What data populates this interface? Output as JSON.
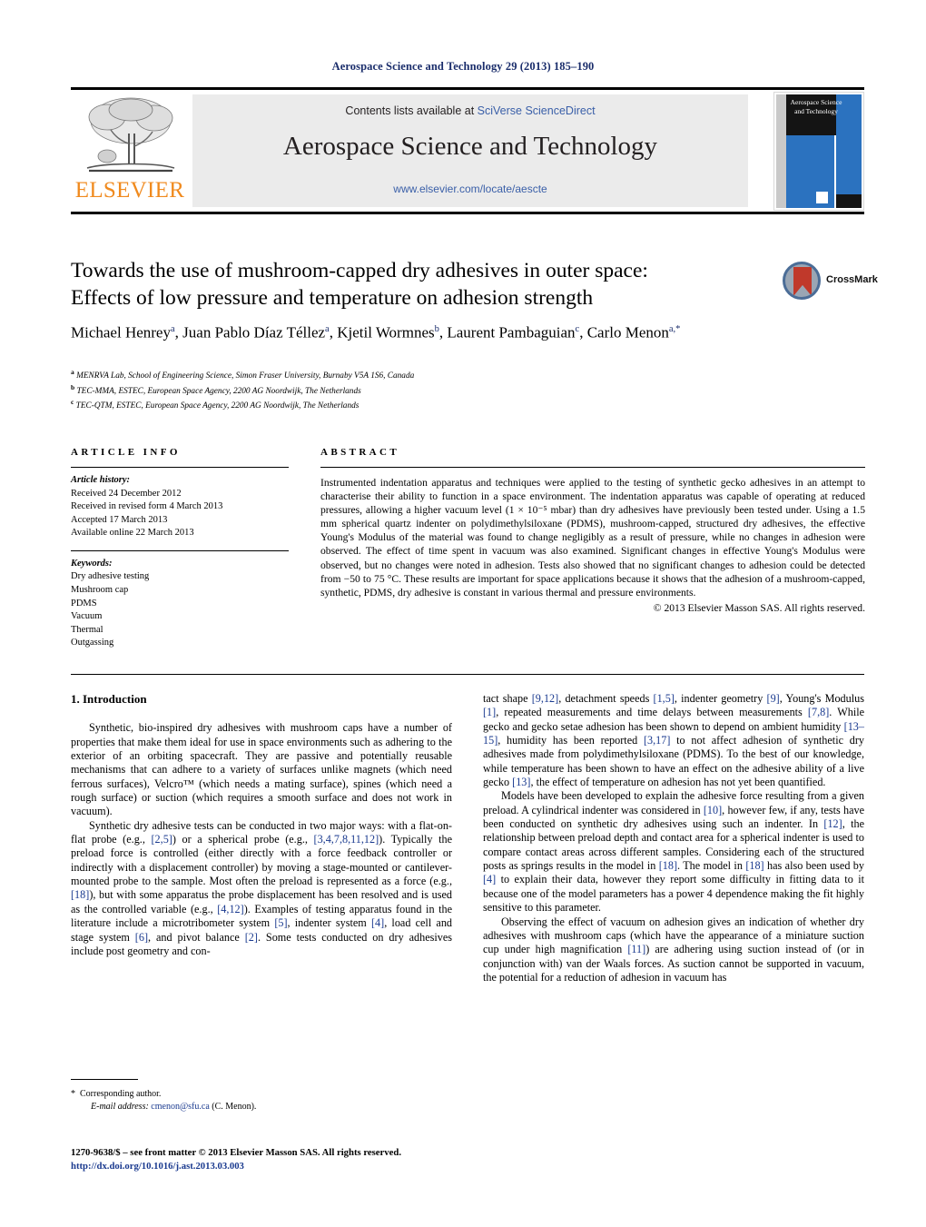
{
  "running_head": "Aerospace Science and Technology 29 (2013) 185–190",
  "masthead": {
    "publisher_name": "ELSEVIER",
    "contents_prefix": "Contents lists available at ",
    "sciencedirect_link": "SciVerse ScienceDirect",
    "journal_title": "Aerospace Science and Technology",
    "journal_url": "www.elsevier.com/locate/aescte",
    "cover_title": "Aerospace Science and Technology"
  },
  "article": {
    "title_line1": "Towards the use of mushroom-capped dry adhesives in outer space:",
    "title_line2": "Effects of low pressure and temperature on adhesion strength",
    "authors": [
      {
        "name": "Michael Henrey",
        "sup": "a",
        "sep": ", "
      },
      {
        "name": "Juan Pablo Díaz Téllez",
        "sup": "a",
        "sep": ", "
      },
      {
        "name": "Kjetil Wormnes",
        "sup": "b",
        "sep": ", "
      },
      {
        "name": "Laurent Pambaguian",
        "sup": "c",
        "sep": ", "
      },
      {
        "name": "Carlo Menon",
        "sup": "a,*",
        "sep": ""
      }
    ],
    "affiliations": [
      {
        "marker": "a",
        "text": "MENRVA Lab, School of Engineering Science, Simon Fraser University, Burnaby V5A 1S6, Canada"
      },
      {
        "marker": "b",
        "text": "TEC-MMA, ESTEC, European Space Agency, 2200 AG Noordwijk, The Netherlands"
      },
      {
        "marker": "c",
        "text": "TEC-QTM, ESTEC, European Space Agency, 2200 AG Noordwijk, The Netherlands"
      }
    ],
    "crossmark_label": "CrossMark"
  },
  "article_info": {
    "heading": "ARTICLE INFO",
    "history_label": "Article history:",
    "history": [
      "Received 24 December 2012",
      "Received in revised form 4 March 2013",
      "Accepted 17 March 2013",
      "Available online 22 March 2013"
    ],
    "keywords_label": "Keywords:",
    "keywords": [
      "Dry adhesive testing",
      "Mushroom cap",
      "PDMS",
      "Vacuum",
      "Thermal",
      "Outgassing"
    ]
  },
  "abstract": {
    "heading": "ABSTRACT",
    "text": "Instrumented indentation apparatus and techniques were applied to the testing of synthetic gecko adhesives in an attempt to characterise their ability to function in a space environment. The indentation apparatus was capable of operating at reduced pressures, allowing a higher vacuum level (1 × 10⁻⁵ mbar) than dry adhesives have previously been tested under. Using a 1.5 mm spherical quartz indenter on polydimethylsiloxane (PDMS), mushroom-capped, structured dry adhesives, the effective Young's Modulus of the material was found to change negligibly as a result of pressure, while no changes in adhesion were observed. The effect of time spent in vacuum was also examined. Significant changes in effective Young's Modulus were observed, but no changes were noted in adhesion. Tests also showed that no significant changes to adhesion could be detected from −50 to 75 °C. These results are important for space applications because it shows that the adhesion of a mushroom-capped, synthetic, PDMS, dry adhesive is constant in various thermal and pressure environments.",
    "copyright": "© 2013 Elsevier Masson SAS. All rights reserved."
  },
  "body": {
    "section_heading": "1. Introduction",
    "left_paragraphs": [
      "Synthetic, bio-inspired dry adhesives with mushroom caps have a number of properties that make them ideal for use in space environments such as adhering to the exterior of an orbiting spacecraft. They are passive and potentially reusable mechanisms that can adhere to a variety of surfaces unlike magnets (which need ferrous surfaces), Velcro™ (which needs a mating surface), spines (which need a rough surface) or suction (which requires a smooth surface and does not work in vacuum).",
      "Synthetic dry adhesive tests can be conducted in two major ways: with a flat-on-flat probe (e.g., [2,5]) or a spherical probe (e.g., [3,4,7,8,11,12]). Typically the preload force is controlled (either directly with a force feedback controller or indirectly with a displacement controller) by moving a stage-mounted or cantilever-mounted probe to the sample. Most often the preload is represented as a force (e.g., [18]), but with some apparatus the probe displacement has been resolved and is used as the controlled variable (e.g., [4,12]). Examples of testing apparatus found in the literature include a microtribometer system [5], indenter system [4], load cell and stage system [6], and pivot balance [2]. Some tests conducted on dry adhesives include post geometry and con-"
    ],
    "right_paragraphs": [
      "tact shape [9,12], detachment speeds [1,5], indenter geometry [9], Young's Modulus [1], repeated measurements and time delays between measurements [7,8]. While gecko and gecko setae adhesion has been shown to depend on ambient humidity [13–15], humidity has been reported [3,17] to not affect adhesion of synthetic dry adhesives made from polydimethylsiloxane (PDMS). To the best of our knowledge, while temperature has been shown to have an effect on the adhesive ability of a live gecko [13], the effect of temperature on adhesion has not yet been quantified.",
      "Models have been developed to explain the adhesive force resulting from a given preload. A cylindrical indenter was considered in [10], however few, if any, tests have been conducted on synthetic dry adhesives using such an indenter. In [12], the relationship between preload depth and contact area for a spherical indenter is used to compare contact areas across different samples. Considering each of the structured posts as springs results in the model in [18]. The model in [18] has also been used by [4] to explain their data, however they report some difficulty in fitting data to it because one of the model parameters has a power 4 dependence making the fit highly sensitive to this parameter.",
      "Observing the effect of vacuum on adhesion gives an indication of whether dry adhesives with mushroom caps (which have the appearance of a miniature suction cup under high magnification [11]) are adhering using suction instead of (or in conjunction with) van der Waals forces. As suction cannot be supported in vacuum, the potential for a reduction of adhesion in vacuum has"
    ]
  },
  "footnotes": {
    "corresponding_marker": "*",
    "corresponding_text": "Corresponding author.",
    "email_label": "E-mail address:",
    "email_address": "cmenon@sfu.ca",
    "email_owner": "(C. Menon).",
    "imprint_line": "1270-9638/$ – see front matter © 2013 Elsevier Masson SAS. All rights reserved.",
    "doi_line": "http://dx.doi.org/10.1016/j.ast.2013.03.003"
  },
  "colors": {
    "link_blue": "#1a3a8f",
    "elsevier_orange": "#f08a1e",
    "cover_blue": "#2b72bf"
  }
}
